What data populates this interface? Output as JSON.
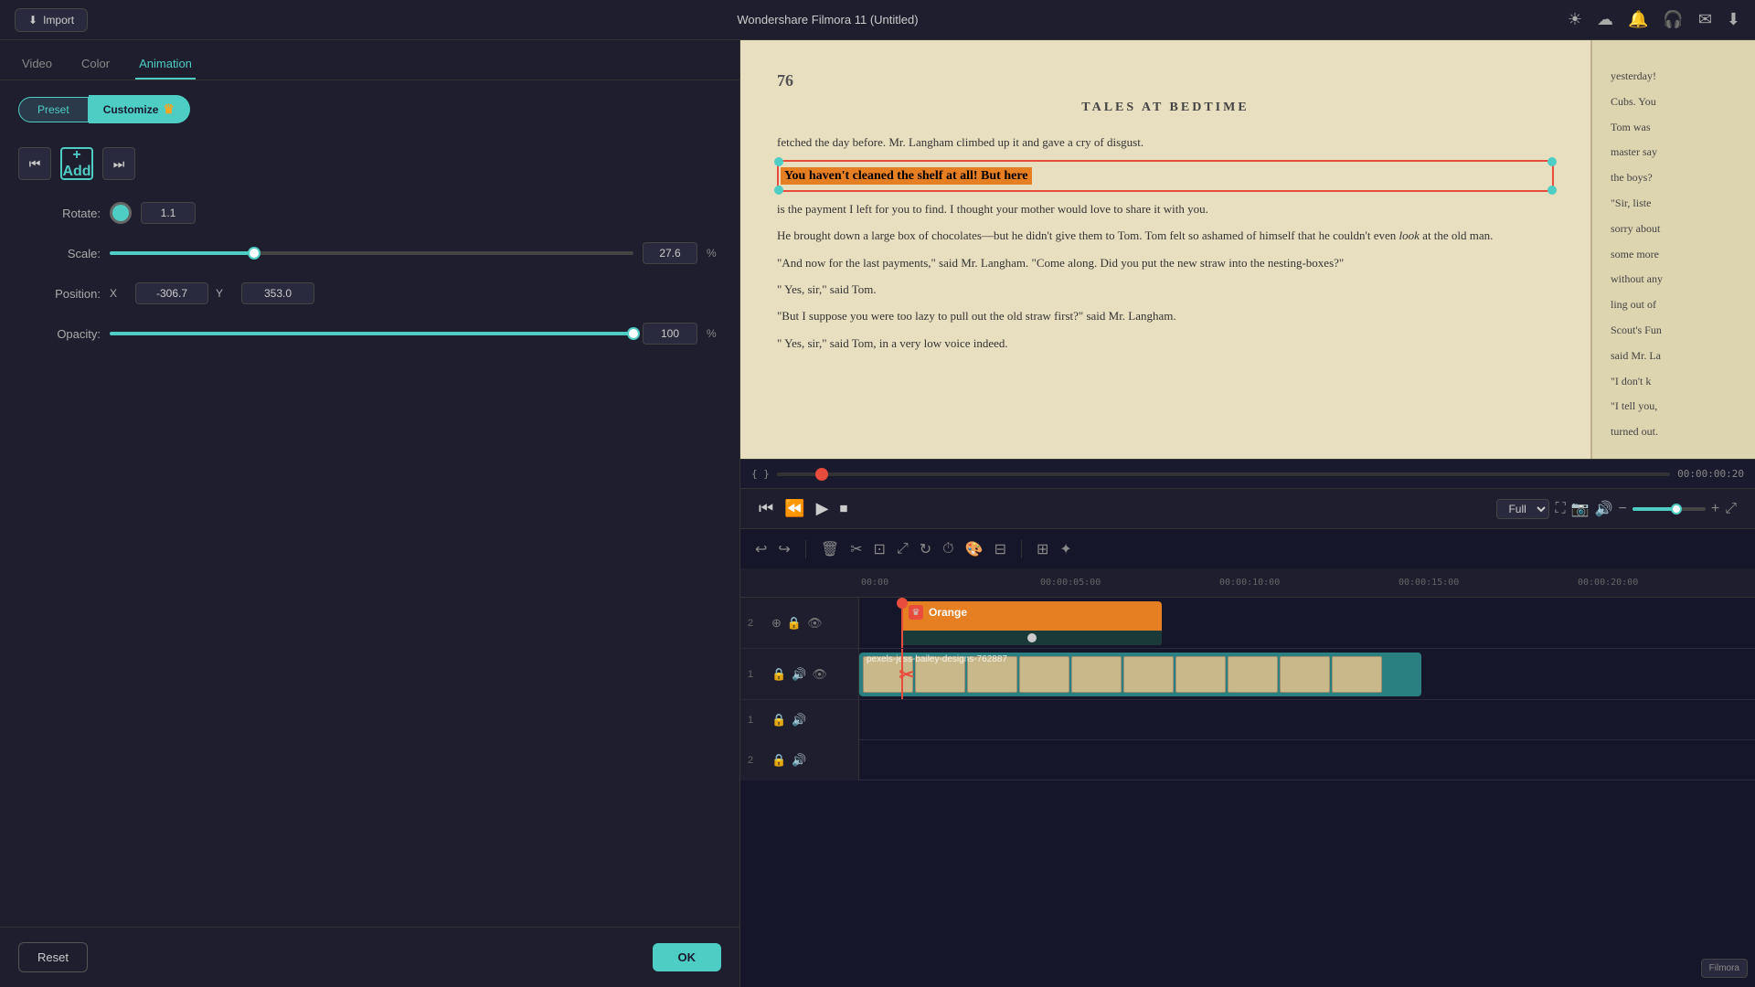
{
  "app": {
    "title": "Wondershare Filmora 11 (Untitled)",
    "import_label": "Import"
  },
  "tabs": {
    "video": "Video",
    "color": "Color",
    "animation": "Animation",
    "active": "Animation"
  },
  "preset_bar": {
    "preset_label": "Preset",
    "customize_label": "Customize"
  },
  "controls": {
    "rotate_label": "Rotate:",
    "rotate_value": "1.1",
    "scale_label": "Scale:",
    "scale_value": "27.6",
    "scale_unit": "%",
    "scale_percent": 27.6,
    "position_label": "Position:",
    "position_x_label": "X",
    "position_x_value": "-306.7",
    "position_y_label": "Y",
    "position_y_value": "353.0",
    "opacity_label": "Opacity:",
    "opacity_value": "100",
    "opacity_unit": "%",
    "opacity_percent": 100
  },
  "buttons": {
    "reset": "Reset",
    "ok": "OK",
    "add": "+ Add"
  },
  "timeline": {
    "markers": [
      "00:00",
      "00:00:05:00",
      "00:00:10:00",
      "00:00:15:00",
      "00:00:20:00"
    ],
    "timecode": "00:00:00:20",
    "quality": "Full"
  },
  "tracks": [
    {
      "num": "2",
      "type": "video",
      "label": "Orange",
      "clip_color": "orange"
    },
    {
      "num": "1",
      "type": "video",
      "label": "pexels-jess-bailey-designs-762887",
      "clip_color": "teal"
    },
    {
      "num": "1",
      "type": "audio",
      "label": ""
    },
    {
      "num": "2",
      "type": "audio",
      "label": ""
    }
  ],
  "book": {
    "page_number": "76",
    "chapter_title": "TALES AT BEDTIME",
    "highlight_text": "You haven't cleaned the shelf at all!  But here",
    "text_lines": [
      "fetched the day before. Mr. Langham climbed up",
      "it and gave a cry of disgust.",
      "is the payment I left for you to find.  I thought",
      "your mother would love to share it with you.",
      "He brought down a large box of chocolates—but",
      "he didn't give them to Tom.  Tom felt so ashamed",
      "of himself that he couldn't even look at the old",
      "man.",
      "\"And now for the last payments,\" said Mr.",
      "Langham.  \"Come along.  Did you put the new",
      "straw into the nesting-boxes?\"",
      "\" Yes, sir,\" said Tom.",
      "\"But I suppose you were too lazy to pull out the",
      "old straw first?\" said Mr. Langham.",
      "\" Yes, sir,\" said Tom, in a very low voice indeed."
    ],
    "right_page_lines": [
      "yesterday!",
      "Cubs. You",
      "Tom was",
      "master say",
      "the boys?",
      "\"Sir, liste",
      "sorry about",
      "some more",
      "without any",
      "ling out of",
      "Scout's Fun",
      "said Mr. La",
      "\"I don't k",
      "\"I tell you,",
      "turned out."
    ]
  },
  "icons": {
    "import": "⬇",
    "sun": "☀",
    "cloud": "☁",
    "bell": "🔔",
    "headphone": "🎧",
    "mail": "✉",
    "download": "⬇",
    "undo": "↩",
    "redo": "↪",
    "delete": "🗑",
    "cut": "✂",
    "crop": "⊡",
    "transform": "⤢",
    "rotate_icon": "↻",
    "timer": "⏱",
    "color": "🎨",
    "split": "⊟",
    "speed": "⚡",
    "prev": "⏮",
    "play": "▶",
    "pause": "⏸",
    "stop": "⏹",
    "next": "⏭",
    "rewind": "⏪",
    "fast_play": "⏩",
    "skip_back": "⏭",
    "fullscreen": "⛶",
    "camera": "📷",
    "volume": "🔊",
    "zoom_out": "🔍",
    "zoom_in": "🔎"
  }
}
